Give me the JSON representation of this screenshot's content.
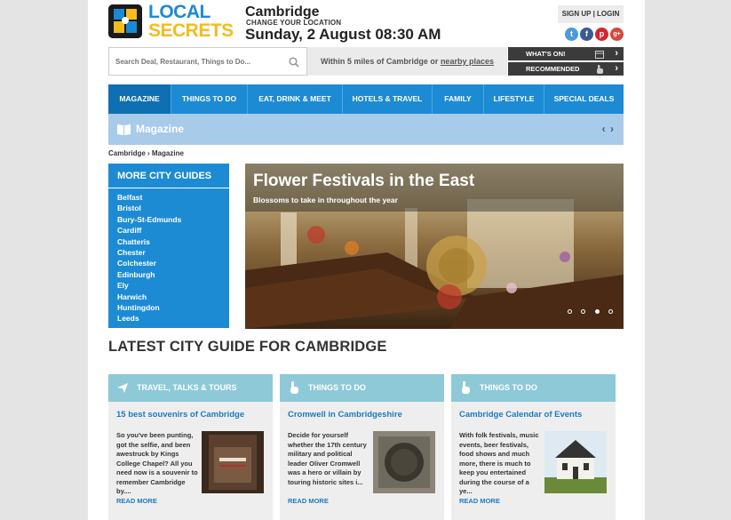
{
  "header": {
    "logo_line1": "LOCAL",
    "logo_line2": "SECRETS",
    "city": "Cambridge",
    "change_location": "CHANGE YOUR LOCATION",
    "datetime": "Sunday, 2 August 08:30 AM",
    "auth_label": "SIGN UP | LOGIN",
    "social": [
      {
        "icon": "twitter-icon",
        "glyph": "t",
        "color": "#4a9bd9"
      },
      {
        "icon": "facebook-icon",
        "glyph": "f",
        "color": "#3a5a98"
      },
      {
        "icon": "pinterest-icon",
        "glyph": "p",
        "color": "#d2272f"
      },
      {
        "icon": "googleplus-icon",
        "glyph": "g+",
        "color": "#d44a3a"
      }
    ]
  },
  "search": {
    "placeholder": "Search Deal, Restaurant, Things to Do...",
    "radius_text": "Within 5 miles of Cambridge or ",
    "nearby_link": "nearby places"
  },
  "quick_buttons": {
    "whats_on": "WHAT'S ON!",
    "recommended": "RECOMMENDED"
  },
  "nav": {
    "items": [
      "MAGAZINE",
      "THINGS TO DO",
      "EAT, DRINK & MEET",
      "HOTELS & TRAVEL",
      "FAMILY",
      "LIFESTYLE",
      "SPECIAL DEALS"
    ]
  },
  "section": {
    "title": "Magazine",
    "arrows": "‹ ›"
  },
  "breadcrumb": "Cambridge › Magazine",
  "city_guides": {
    "title": "MORE CITY GUIDES",
    "items": [
      "Belfast",
      "Bristol",
      "Bury-St-Edmunds",
      "Cardiff",
      "Chatteris",
      "Chester",
      "Colchester",
      "Edinburgh",
      "Ely",
      "Harwich",
      "Huntingdon",
      "Leeds"
    ]
  },
  "hero": {
    "title": "Flower Festivals in the East",
    "subtitle": "Blossoms to take in throughout the year"
  },
  "latest": {
    "heading": "LATEST CITY GUIDE FOR CAMBRIDGE",
    "cards": [
      {
        "category": "TRAVEL, TALKS & TOURS",
        "icon": "plane-icon",
        "title": "15 best souvenirs of Cambridge",
        "body": "So you've been punting, got the selfie, and been awestruck by Kings College Chapel? All you need now is a souvenir to remember Cambridge by....",
        "read_more": "READ MORE"
      },
      {
        "category": "THINGS TO DO",
        "icon": "hand-pointer-icon",
        "title": "Cromwell in Cambridgeshire",
        "body": "Decide for yourself whether the 17th century military and political leader Oliver Cromwell was a hero or villain by touring historic sites i...",
        "read_more": "READ MORE"
      },
      {
        "category": "THINGS TO DO",
        "icon": "hand-pointer-icon",
        "title": "Cambridge Calendar of Events",
        "body": "With folk festivals, music events, beer festivals, food shows and much more, there is much to keep you entertained during the course of a ye...",
        "read_more": "READ MORE"
      }
    ]
  }
}
